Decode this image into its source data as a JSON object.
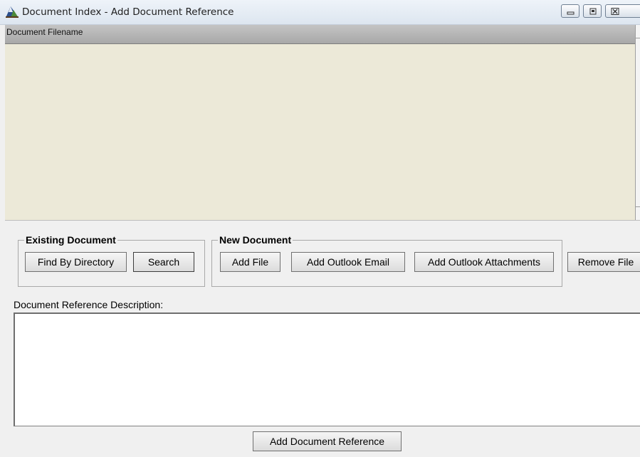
{
  "window": {
    "title": "Document Index - Add Document Reference"
  },
  "file_list": {
    "column_header": "Document Filename",
    "rows": []
  },
  "existing_document": {
    "title": "Existing Document",
    "find_by_directory": "Find By Directory",
    "search": "Search"
  },
  "new_document": {
    "title": "New Document",
    "add_file": "Add File",
    "add_outlook_email": "Add Outlook Email",
    "add_outlook_attachments": "Add Outlook Attachments"
  },
  "remove_file": "Remove File",
  "description": {
    "label": "Document Reference Description:",
    "value": ""
  },
  "add_document_reference": "Add Document Reference",
  "colors": {
    "list_background": "#ece9d8",
    "header_background": "#b4b4b4",
    "window_background": "#f0f0f0"
  }
}
